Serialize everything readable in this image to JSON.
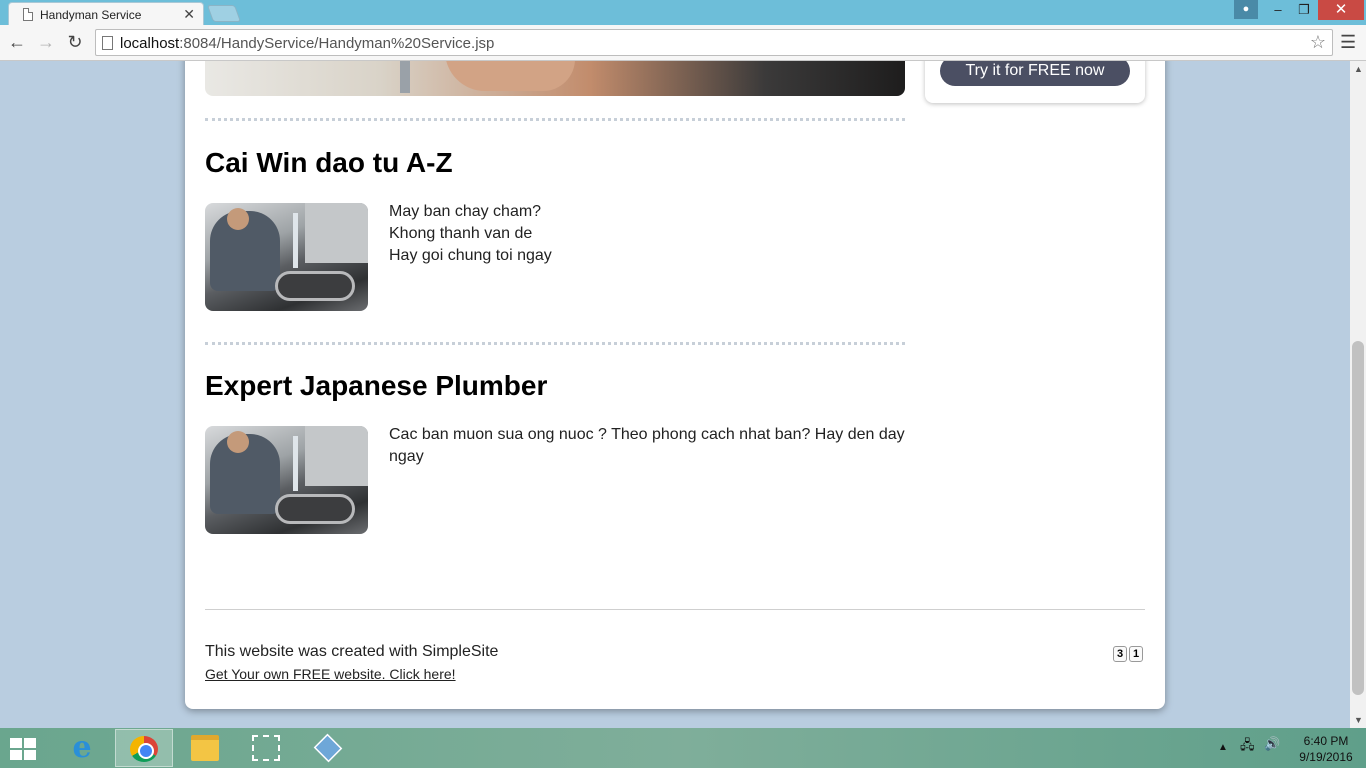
{
  "browser": {
    "tab_title": "Handyman Service",
    "tab_close": "✕",
    "url_host": "localhost",
    "url_rest": ":8084/HandyService/Handyman%20Service.jsp",
    "window_min": "–",
    "window_max": "❐",
    "window_close": "✕"
  },
  "sidebar": {
    "cta_label": "Try it for FREE now"
  },
  "sections": [
    {
      "title": "Cai Win dao tu A-Z",
      "lines": [
        "May ban chay cham?",
        "Khong thanh van de",
        "Hay goi chung toi ngay"
      ]
    },
    {
      "title": "Expert Japanese Plumber",
      "lines": [
        "Cac ban muon sua ong nuoc ? Theo phong cach nhat ban? Hay den day",
        "ngay"
      ]
    }
  ],
  "footer": {
    "created_with": "This website was created with SimpleSite",
    "cta_link": "Get Your own FREE website. Click here!",
    "counter": [
      "3",
      "1"
    ]
  },
  "taskbar": {
    "time": "6:40 PM",
    "date": "9/19/2016"
  }
}
